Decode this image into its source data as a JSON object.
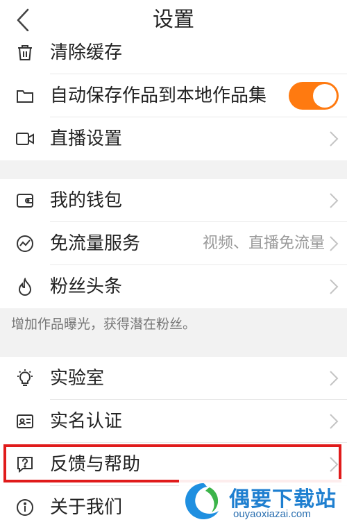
{
  "header": {
    "title": "设置"
  },
  "section1": {
    "items": [
      {
        "label": "清除缓存"
      },
      {
        "label": "自动保存作品到本地作品集",
        "toggle_on": true
      },
      {
        "label": "直播设置"
      }
    ]
  },
  "section2": {
    "items": [
      {
        "label": "我的钱包"
      },
      {
        "label": "免流量服务",
        "value": "视频、直播免流量"
      },
      {
        "label": "粉丝头条"
      }
    ],
    "hint": "增加作品曝光，获得潜在粉丝。"
  },
  "section3": {
    "items": [
      {
        "label": "实验室"
      },
      {
        "label": "实名认证"
      },
      {
        "label": "反馈与帮助"
      },
      {
        "label": "关于我们"
      }
    ]
  },
  "watermark": {
    "text": "偶要下载站",
    "url": "ouyaoxiazai.com"
  },
  "colors": {
    "accent": "#ff7a10",
    "highlight": "#e01b1b"
  }
}
